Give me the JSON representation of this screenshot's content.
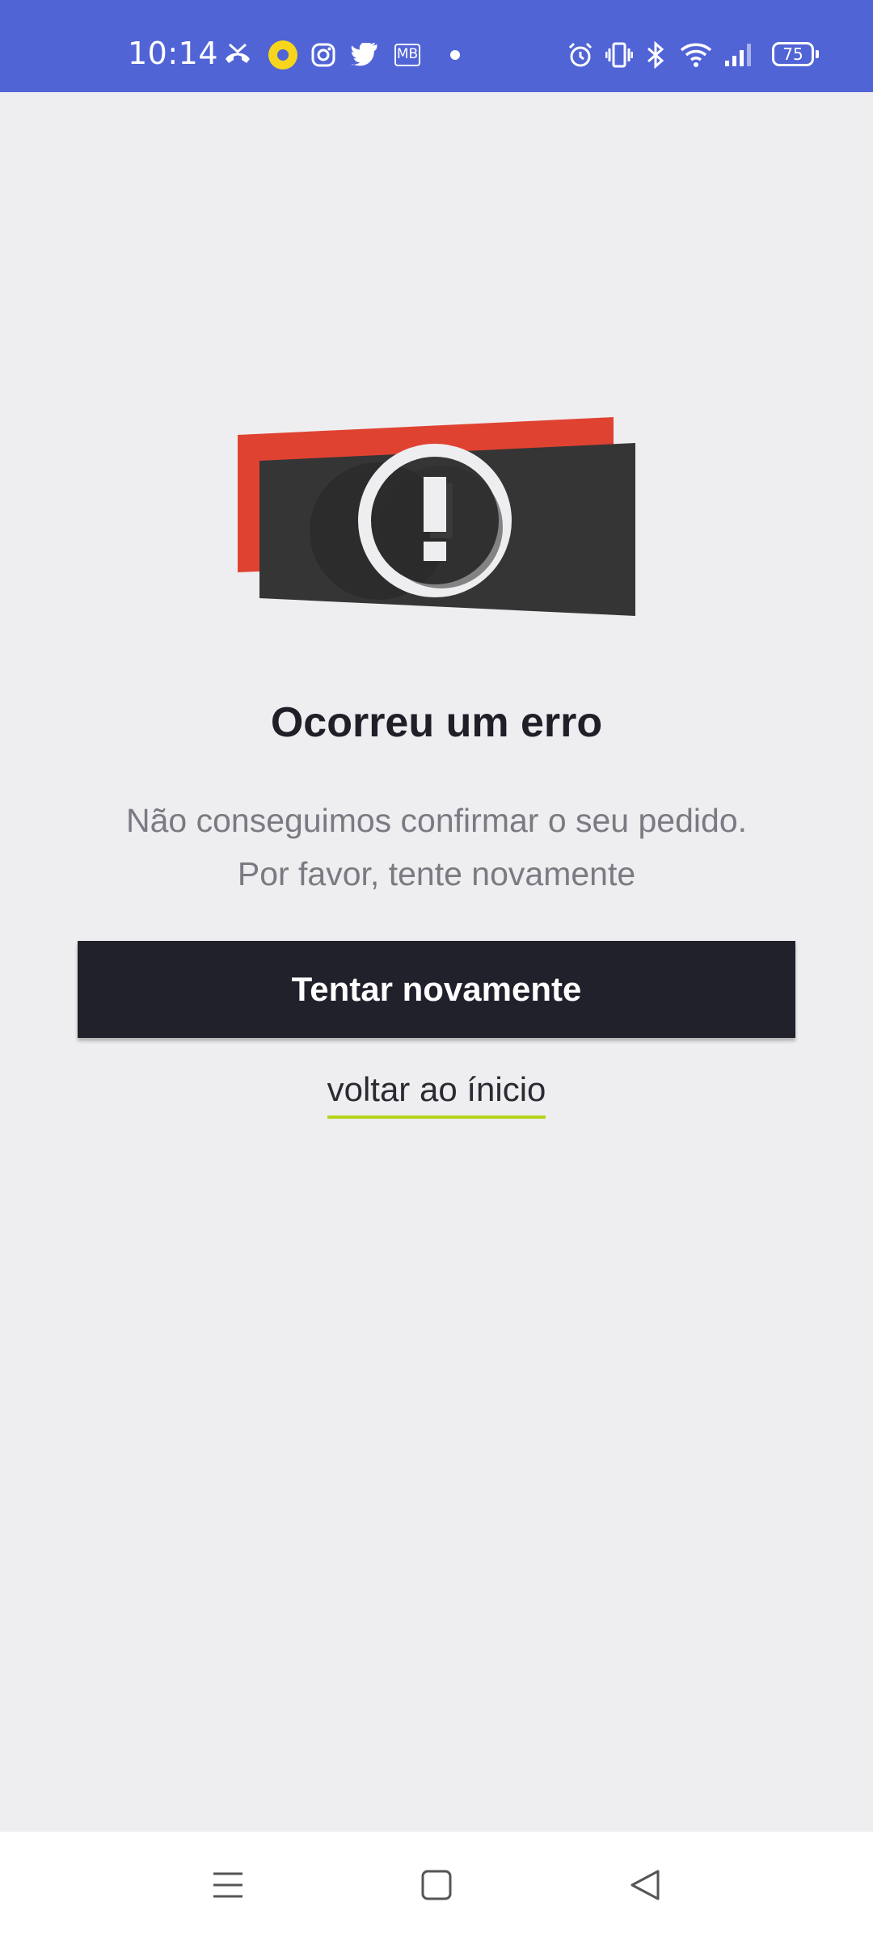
{
  "status_bar": {
    "time": "10:14",
    "battery": "75",
    "background": "#5064d6",
    "icons": [
      "missed-call-icon",
      "notification-dot-icon",
      "instagram-icon",
      "twitter-icon",
      "mb-app-icon",
      "more-dot-icon",
      "alarm-icon",
      "vibrate-icon",
      "bluetooth-icon",
      "wifi-icon",
      "signal-icon",
      "battery-icon"
    ],
    "mb_label": "MB"
  },
  "error": {
    "title": "Ocorreu um erro",
    "message_line1": "Não conseguimos confirmar o seu pedido.",
    "message_line2": "Por favor, tente novamente",
    "illustration_icon": "exclamation-icon",
    "accent_red": "#e04232",
    "panel_dark": "#353535"
  },
  "actions": {
    "retry_label": "Tentar novamente",
    "home_label": "voltar ao ínicio",
    "underline_color": "#b6d31a"
  },
  "nav_bar": {
    "icons": [
      "menu-icon",
      "home-square-icon",
      "back-triangle-icon"
    ]
  }
}
